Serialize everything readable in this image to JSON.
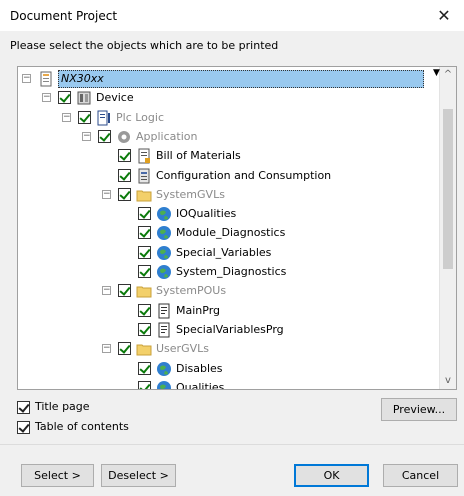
{
  "window": {
    "title": "Document Project",
    "close_glyph": "✕"
  },
  "instructions": "Please select the objects which are to be printed",
  "tree": {
    "items": [
      {
        "label": "NX30xx",
        "icon": "project-icon",
        "checked": false,
        "expander": "−",
        "selected": true,
        "gray": false
      },
      {
        "label": "Device",
        "icon": "device-icon",
        "checked": true,
        "expander": "−",
        "selected": false,
        "gray": false
      },
      {
        "label": "Plc Logic",
        "icon": "plc-logic-icon",
        "checked": true,
        "expander": "−",
        "selected": false,
        "gray": true
      },
      {
        "label": "Application",
        "icon": "application-gear-icon",
        "checked": true,
        "expander": "−",
        "selected": false,
        "gray": true
      },
      {
        "label": "Bill of Materials",
        "icon": "bill-of-materials-icon",
        "checked": true,
        "expander": "",
        "selected": false,
        "gray": false
      },
      {
        "label": "Configuration and Consumption",
        "icon": "configuration-icon",
        "checked": true,
        "expander": "",
        "selected": false,
        "gray": false
      },
      {
        "label": "SystemGVLs",
        "icon": "folder-icon",
        "checked": true,
        "expander": "−",
        "selected": false,
        "gray": true
      },
      {
        "label": "IOQualities",
        "icon": "globe-icon",
        "checked": true,
        "expander": "",
        "selected": false,
        "gray": false
      },
      {
        "label": "Module_Diagnostics",
        "icon": "globe-icon",
        "checked": true,
        "expander": "",
        "selected": false,
        "gray": false
      },
      {
        "label": "Special_Variables",
        "icon": "globe-icon",
        "checked": true,
        "expander": "",
        "selected": false,
        "gray": false
      },
      {
        "label": "System_Diagnostics",
        "icon": "globe-icon",
        "checked": true,
        "expander": "",
        "selected": false,
        "gray": false
      },
      {
        "label": "SystemPOUs",
        "icon": "folder-icon",
        "checked": true,
        "expander": "−",
        "selected": false,
        "gray": true
      },
      {
        "label": "MainPrg",
        "icon": "pou-document-icon",
        "checked": true,
        "expander": "",
        "selected": false,
        "gray": false
      },
      {
        "label": "SpecialVariablesPrg",
        "icon": "pou-document-icon",
        "checked": true,
        "expander": "",
        "selected": false,
        "gray": false
      },
      {
        "label": "UserGVLs",
        "icon": "folder-icon",
        "checked": true,
        "expander": "−",
        "selected": false,
        "gray": true
      },
      {
        "label": "Disables",
        "icon": "globe-icon",
        "checked": true,
        "expander": "",
        "selected": false,
        "gray": false
      },
      {
        "label": "Qualities",
        "icon": "globe-icon",
        "checked": true,
        "expander": "",
        "selected": false,
        "gray": false
      }
    ],
    "dropdown_glyph": "▼",
    "scroll_up_glyph": "^",
    "scroll_down_glyph": "v"
  },
  "options": {
    "title_page": "Title page",
    "table_of_contents": "Table of contents"
  },
  "buttons": {
    "preview": "Preview...",
    "select": "Select >",
    "deselect": "Deselect >",
    "ok": "OK",
    "cancel": "Cancel"
  },
  "colors": {
    "selection": "#99c9ef",
    "checkmark": "#0a7a0a",
    "gray_text": "#8a8a8a",
    "accent": "#0078d7"
  }
}
